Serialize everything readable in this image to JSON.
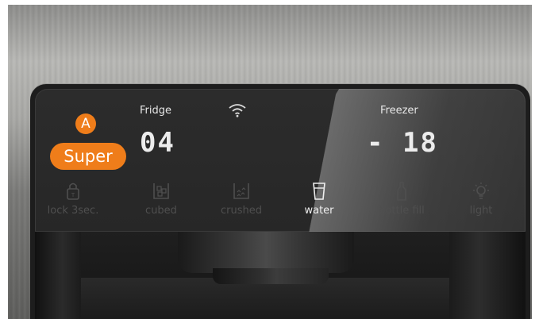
{
  "brand_colors": {
    "accent_orange": "#ef7d1a",
    "panel_dark": "#2a2a2a",
    "text_light": "#e6e6e6",
    "text_dim": "#4f4f4f"
  },
  "display": {
    "fridge": {
      "label": "Fridge",
      "value": "04"
    },
    "freezer": {
      "label": "Freezer",
      "value": "- 18"
    },
    "wifi_icon": "wifi-icon"
  },
  "super_function": {
    "badge": "A",
    "button_label": "Super"
  },
  "functions": [
    {
      "label": "lock 3sec.",
      "icon": "lock-icon",
      "active": false
    },
    {
      "label": "cubed",
      "icon": "ice-cubes-icon",
      "active": false
    },
    {
      "label": "crushed",
      "icon": "crushed-ice-icon",
      "active": false
    },
    {
      "label": "water",
      "icon": "water-glass-icon",
      "active": true
    },
    {
      "label": "bottle fill",
      "icon": "bottle-icon",
      "active": false
    },
    {
      "label": "light",
      "icon": "light-bulb-icon",
      "active": false
    }
  ]
}
